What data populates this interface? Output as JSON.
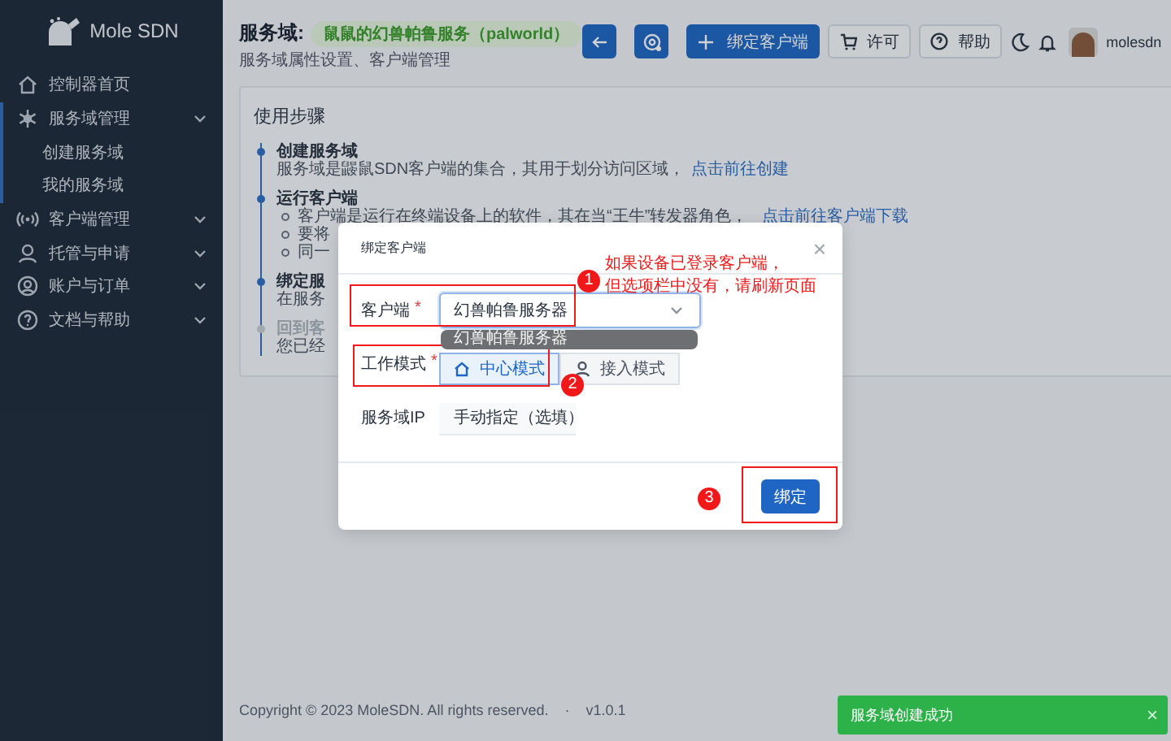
{
  "sidebar": {
    "logo": "Mole SDN",
    "items": [
      {
        "label": "控制器首页",
        "selected": false,
        "expandable": false
      },
      {
        "label": "服务域管理",
        "selected": true,
        "expandable": true,
        "children": [
          {
            "label": "创建服务域"
          },
          {
            "label": "我的服务域"
          }
        ]
      },
      {
        "label": "客户端管理",
        "selected": false,
        "expandable": true
      },
      {
        "label": "托管与申请",
        "selected": false,
        "expandable": true
      },
      {
        "label": "账户与订单",
        "selected": false,
        "expandable": true
      },
      {
        "label": "文档与帮助",
        "selected": false,
        "expandable": true
      }
    ]
  },
  "header": {
    "title": "服务域:",
    "domain": "鼠鼠的幻兽帕鲁服务（palworld）",
    "subtitle": "服务域属性设置、客户端管理",
    "actions": [
      {
        "kind": "icon"
      },
      {
        "kind": "icon"
      },
      {
        "kind": "primary",
        "label": "绑定客户端"
      },
      {
        "kind": "plain",
        "label": "许可"
      },
      {
        "kind": "plain",
        "label": "帮助"
      }
    ],
    "user": "molesdn"
  },
  "steps_card": {
    "title": "使用步骤",
    "steps": [
      {
        "title": "创建服务域",
        "text": "服务域是鼹鼠SDN客户端的集合，其用于划分访问区域，",
        "link": "点击前往创建",
        "disabled": false
      },
      {
        "title": "运行客户端",
        "bullets": [
          {
            "text": "客户端是运行在终端设备上的软件，其在当“王牛”转发器角色，",
            "link": "点击前往客户端下载"
          },
          {
            "text": "要将"
          },
          {
            "text": "同一"
          }
        ],
        "disabled": false
      },
      {
        "title": "绑定服",
        "text": "在服务",
        "disabled": false
      },
      {
        "title": "回到客",
        "text": "您已经",
        "disabled": true
      }
    ]
  },
  "footer": {
    "copyright": "Copyright © 2023 MoleSDN. All rights reserved.",
    "separator": "·",
    "version": "v1.0.1"
  },
  "dialog": {
    "title": "绑定客户端",
    "close": "×",
    "client": {
      "label": "客户端",
      "required_mark": "*",
      "value": "幻兽帕鲁服务器",
      "tooltip": "幻兽帕鲁服务器"
    },
    "mode": {
      "label": "工作模式",
      "required_mark": "*",
      "options": [
        {
          "label": "中心模式",
          "selected": true
        },
        {
          "label": "接入模式",
          "selected": false
        }
      ]
    },
    "ip": {
      "label": "服务域IP",
      "placeholder": "手动指定（选填）"
    },
    "submit": "绑定"
  },
  "annotations": {
    "note": [
      "如果设备已登录客户端，",
      "但选项栏中没有，请刷新页面"
    ],
    "markers": [
      "1",
      "2",
      "3"
    ]
  },
  "toast": {
    "text": "服务域创建成功",
    "close": "×"
  }
}
